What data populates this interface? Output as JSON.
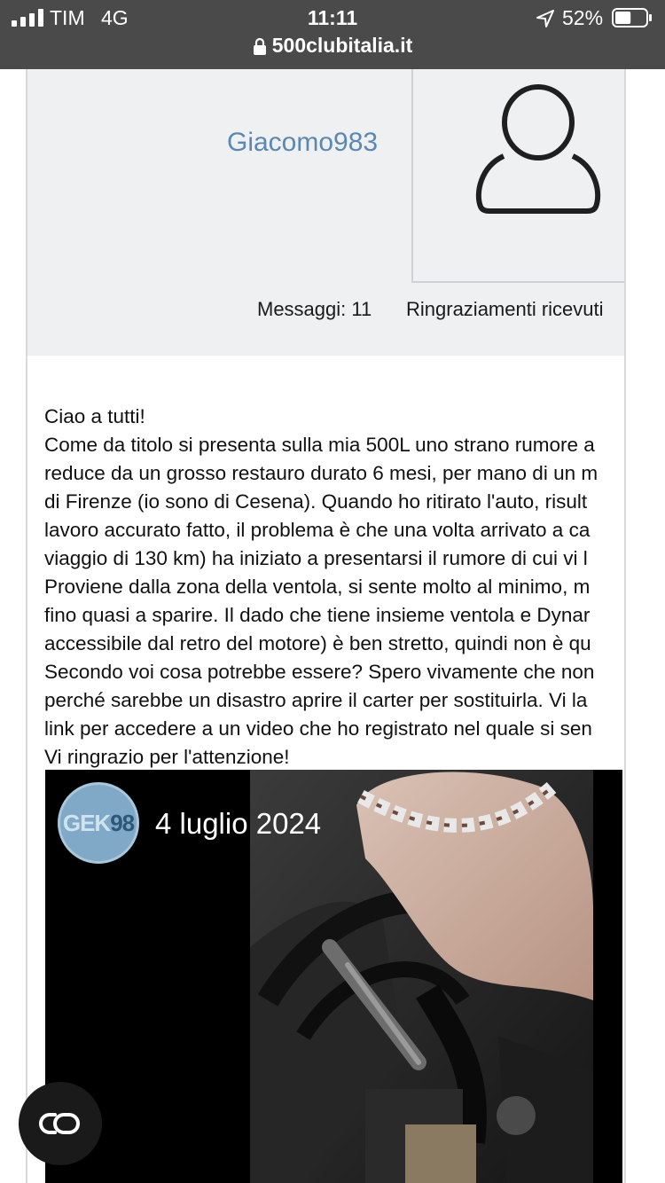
{
  "status_bar": {
    "carrier": "TIM",
    "network": "4G",
    "time": "11:11",
    "battery_percent": "52%",
    "battery_level": 0.52,
    "icons": [
      "signal-icon",
      "location-icon",
      "battery-icon"
    ]
  },
  "address_bar": {
    "url": "500clubitalia.it",
    "icon": "lock-icon"
  },
  "author": {
    "username": "Giacomo983",
    "avatar_icon": "user-silhouette-icon",
    "messages": "Messaggi: 11",
    "thanks": "Ringraziamenti ricevuti"
  },
  "post": {
    "lines": [
      "Ciao a tutti!",
      "Come da titolo si presenta sulla mia 500L uno strano rumore a",
      "reduce da un grosso restauro durato 6 mesi, per mano di un m",
      "di Firenze (io sono di Cesena). Quando ho ritirato l'auto, risult",
      "lavoro accurato fatto, il problema è che una volta arrivato a ca",
      "viaggio di 130 km) ha iniziato a presentarsi il rumore di cui vi l",
      "Proviene dalla zona della ventola, si sente molto al minimo, m",
      "fino quasi a sparire. Il dado che tiene insieme ventola e Dynar",
      "accessibile dal retro del motore) è ben stretto, quindi non è qu",
      "Secondo voi cosa potrebbe essere? Spero vivamente che non",
      "perché sarebbe un disastro aprire il carter per sostituirla. Vi la",
      "link per accedere a un video che ho registrato nel quale si sen",
      "Vi ringrazio per l'attenzione!"
    ]
  },
  "video": {
    "channel_logo_text_a": "GEK",
    "channel_logo_text_b": "98",
    "date": "4 luglio 2024"
  },
  "reader_button": {
    "icon": "reader-mode-icon"
  },
  "colors": {
    "topbar": "#4a4a4a",
    "author_panel": "#eff0f2",
    "username": "#5b87b3",
    "text": "#111111"
  }
}
